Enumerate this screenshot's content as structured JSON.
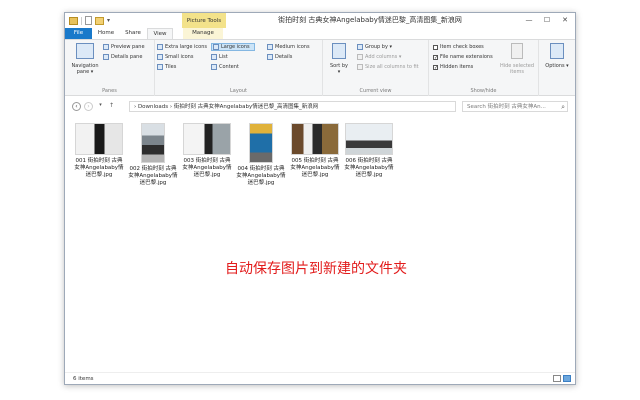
{
  "window": {
    "title": "街拍时刻 古典女神Angelababy情迷巴黎_高清图集_新浪网",
    "contextual_tab": "Picture Tools",
    "qat_dropdown": "▾",
    "controls": {
      "minimize": "—",
      "maximize": "☐",
      "close": "✕"
    }
  },
  "tabs": [
    {
      "label": "File"
    },
    {
      "label": "Home"
    },
    {
      "label": "Share"
    },
    {
      "label": "View"
    },
    {
      "label": "Manage"
    }
  ],
  "ribbon": {
    "panes": {
      "label": "Panes",
      "navigation_pane": "Navigation pane ▾",
      "preview_pane": "Preview pane",
      "details_pane": "Details pane"
    },
    "layout": {
      "label": "Layout",
      "items": [
        "Extra large icons",
        "Large icons",
        "Medium icons",
        "Small icons",
        "List",
        "Details",
        "Tiles",
        "Content"
      ],
      "selected": "Large icons"
    },
    "current_view": {
      "label": "Current view",
      "sort_by": "Sort by ▾",
      "group_by": "Group by ▾",
      "add_columns": "Add columns ▾",
      "size_all_columns": "Size all columns to fit"
    },
    "show_hide": {
      "label": "Show/hide",
      "item_check_boxes": {
        "label": "Item check boxes",
        "checked": false
      },
      "file_name_extensions": {
        "label": "File name extensions",
        "checked": true
      },
      "hidden_items": {
        "label": "Hidden items",
        "checked": true
      },
      "hide_selected": "Hide selected items"
    },
    "options": "Options ▾"
  },
  "address": {
    "path": "›  Downloads  ›  街拍时刻 古典女神Angelababy情迷巴黎_高清图集_新浪网",
    "search_placeholder": "Search 街拍时刻 古典女神An..."
  },
  "files": [
    {
      "name": "001 街拍时刻 古典女神Angelababy情迷巴黎.jpg",
      "orientation": "landscape"
    },
    {
      "name": "002 街拍时刻 古典女神Angelababy情迷巴黎.jpg",
      "orientation": "portrait"
    },
    {
      "name": "003 街拍时刻 古典女神Angelababy情迷巴黎.jpg",
      "orientation": "landscape"
    },
    {
      "name": "004 街拍时刻 古典女神Angelababy情迷巴黎.jpg",
      "orientation": "portrait"
    },
    {
      "name": "005 街拍时刻 古典女神Angelababy情迷巴黎.jpg",
      "orientation": "landscape"
    },
    {
      "name": "006 街拍时刻 古典女神Angelababy情迷巴黎.jpg",
      "orientation": "landscape"
    }
  ],
  "annotation": "自动保存图片到新建的文件夹",
  "status": {
    "item_count": "6 items"
  },
  "colors": {
    "file_tab": "#1979ca",
    "contextual": "#f3e28a",
    "annotation": "#e21b1b",
    "selection": "#cce4f7"
  }
}
